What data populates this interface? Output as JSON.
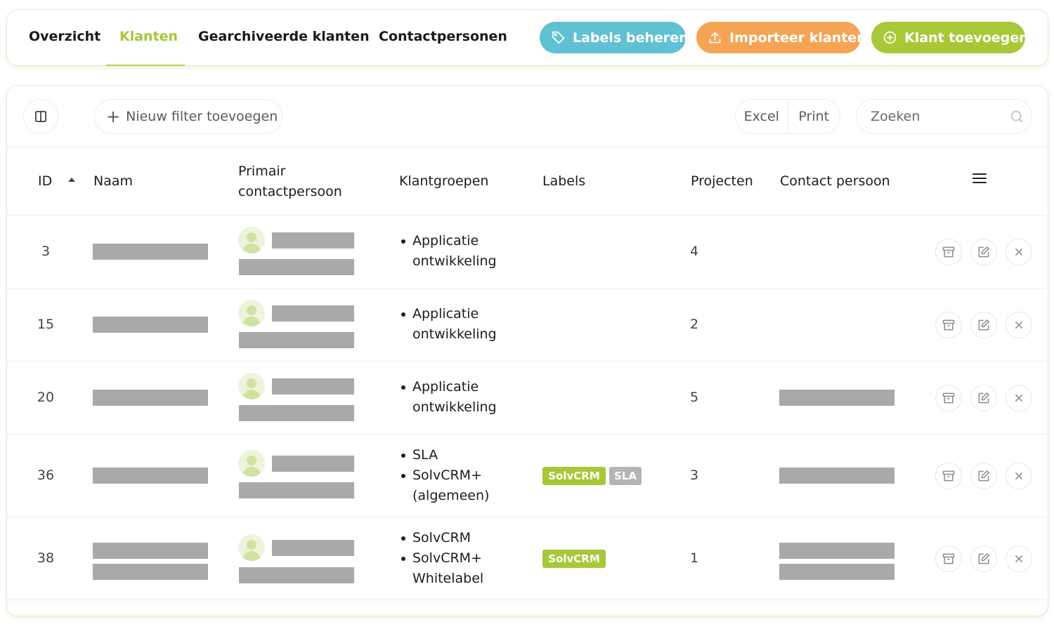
{
  "nav": {
    "tabs": [
      {
        "label": "Overzicht"
      },
      {
        "label": "Klanten"
      },
      {
        "label": "Gearchiveerde klanten"
      },
      {
        "label": "Contactpersonen"
      }
    ],
    "active_tab": "Klanten",
    "buttons": {
      "labels": "Labels beheren",
      "import": "Importeer klanten",
      "add": "Klant toevoegen"
    }
  },
  "colors": {
    "accent_green": "#a8c838",
    "labels_button": "#5fc1d3",
    "import_button": "#f4a453",
    "tag_grey": "#b5b5b5"
  },
  "toolbar": {
    "filter_label": "Nieuw filter toevoegen",
    "export_excel": "Excel",
    "export_print": "Print",
    "search_placeholder": "Zoeken"
  },
  "table": {
    "headers": {
      "id": "ID",
      "naam": "Naam",
      "primair_line1": "Primair",
      "primair_line2": "contactpersoon",
      "klantgroepen": "Klantgroepen",
      "labels": "Labels",
      "projecten": "Projecten",
      "contact": "Contact persoon"
    },
    "sort": {
      "column": "ID",
      "direction": "ascending"
    },
    "rows": [
      {
        "id": "3",
        "groups": [
          [
            "Applicatie",
            "ontwikkeling"
          ]
        ],
        "labels": [],
        "projects": "4"
      },
      {
        "id": "15",
        "groups": [
          [
            "Applicatie",
            "ontwikkeling"
          ]
        ],
        "labels": [],
        "projects": "2"
      },
      {
        "id": "20",
        "groups": [
          [
            "Applicatie",
            "ontwikkeling"
          ]
        ],
        "labels": [],
        "projects": "5"
      },
      {
        "id": "36",
        "groups": [
          [
            "SLA"
          ],
          [
            "SolvCRM+",
            "(algemeen)"
          ]
        ],
        "labels": [
          {
            "text": "SolvCRM",
            "color": "#a8c838"
          },
          {
            "text": "SLA",
            "color": "#b5b5b5"
          }
        ],
        "projects": "3"
      },
      {
        "id": "38",
        "groups": [
          [
            "SolvCRM"
          ],
          [
            "SolvCRM+",
            "Whitelabel"
          ]
        ],
        "labels": [
          {
            "text": "SolvCRM",
            "color": "#a8c838"
          }
        ],
        "projects": "1"
      }
    ]
  }
}
